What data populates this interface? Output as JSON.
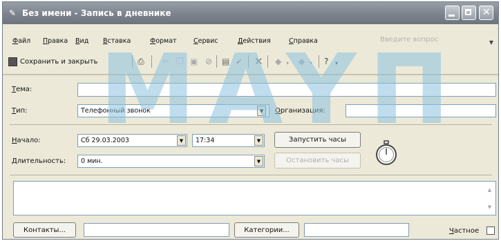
{
  "window": {
    "title": "Без имени - Запись в дневнике",
    "icon": "journal-app-icon",
    "controls": [
      "minimize",
      "maximize",
      "close"
    ]
  },
  "menubar": {
    "items": [
      "Файл",
      "Правка",
      "Вид",
      "Вставка",
      "Формат",
      "Сервис",
      "Действия",
      "Справка"
    ],
    "help_placeholder": "Введите вопрос"
  },
  "toolbar": {
    "save_close_label": "Сохранить и закрыть",
    "icons": [
      "save-icon",
      "print-icon",
      "cut-icon",
      "copy-icon",
      "paste-icon",
      "attach-icon",
      "address-book-icon",
      "check-names-icon",
      "delete-icon",
      "previous-item-icon",
      "next-item-icon",
      "help-icon"
    ]
  },
  "form": {
    "subject_label": "Тема:",
    "subject_value": "",
    "type_label": "Тип:",
    "type_value": "Телефонный звонок",
    "company_label": "Организация:",
    "company_value": "",
    "start_label": "Начало:",
    "start_date": "Сб 29.03.2003",
    "start_time": "17:34",
    "start_timer_label": "Запустить часы",
    "duration_label": "Длительность:",
    "duration_value": "0 мин.",
    "pause_timer_label": "Остановить часы",
    "notes": "",
    "contacts_label": "Контакты...",
    "contacts_value": "",
    "categories_label": "Категории...",
    "categories_value": "",
    "private_label": "Частное",
    "private_checked": false
  },
  "watermark": {
    "text": "MAYП",
    "color": "#8cc2df"
  }
}
